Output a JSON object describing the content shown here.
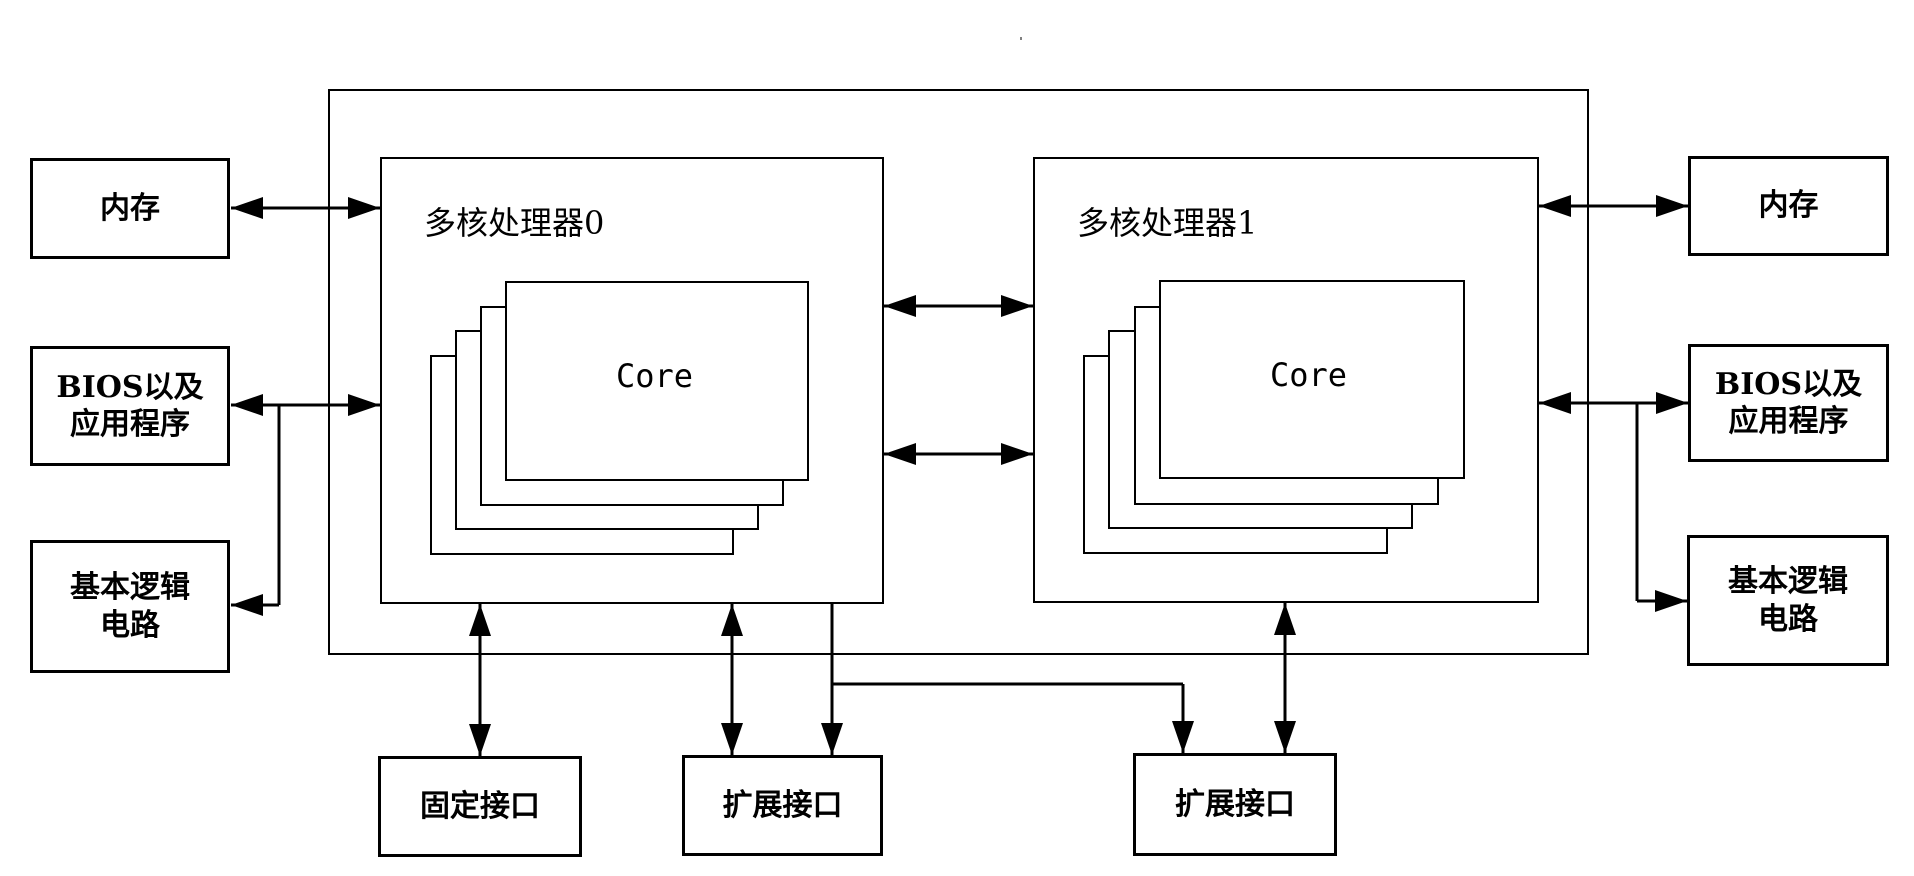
{
  "diagram": {
    "left": {
      "memory": "内存",
      "bios_line1": "BIOS以及",
      "bios_line2": "应用程序",
      "logic_line1": "基本逻辑",
      "logic_line2": "电路"
    },
    "right": {
      "memory": "内存",
      "bios_line1": "BIOS以及",
      "bios_line2": "应用程序",
      "logic_line1": "基本逻辑",
      "logic_line2": "电路"
    },
    "processor0": {
      "title": "多核处理器0",
      "core_label": "Core"
    },
    "processor1": {
      "title": "多核处理器1",
      "core_label": "Core"
    },
    "interfaces": {
      "fixed": "固定接口",
      "expansion0": "扩展接口",
      "expansion1": "扩展接口"
    }
  }
}
